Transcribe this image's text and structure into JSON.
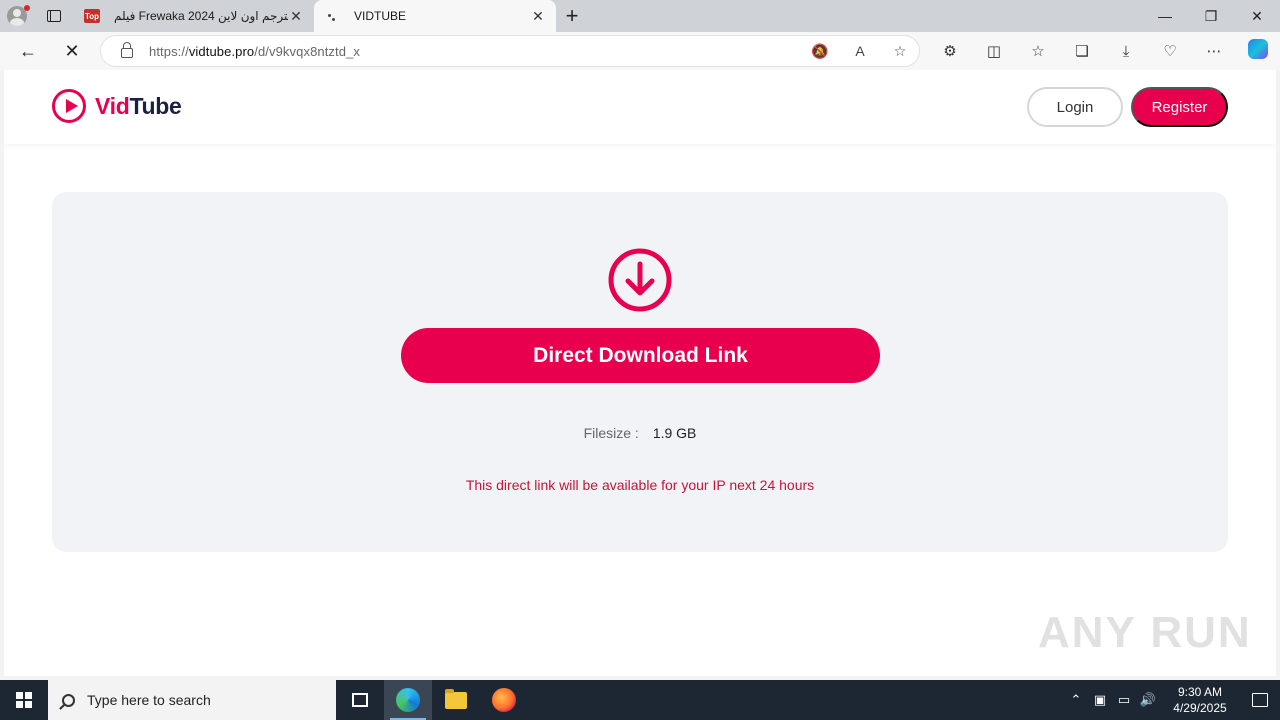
{
  "browser": {
    "tabs": [
      {
        "title": "فيلم Frewaka 2024 مترجم اون لاين",
        "favicon": "Top",
        "active": false
      },
      {
        "title": "VIDTUBE",
        "favicon": "",
        "active": true
      }
    ],
    "url_scheme": "https://",
    "url_host": "vidtube.pro",
    "url_path": "/d/v9kvqx8ntztd_x",
    "window_controls": {
      "minimize": "—",
      "restore": "❐",
      "close": "✕"
    }
  },
  "site": {
    "logo_vid": "Vid",
    "logo_tube": "Tube",
    "login_label": "Login",
    "register_label": "Register",
    "accent_color": "#e8004e"
  },
  "download": {
    "button_label": "Direct Download Link",
    "filesize_label": "Filesize :",
    "filesize_value": "1.9 GB",
    "notice": "This direct link will be available for your IP next 24 hours"
  },
  "watermark": "ANY RUN",
  "taskbar": {
    "search_placeholder": "Type here to search",
    "time": "9:30 AM",
    "date": "4/29/2025"
  }
}
